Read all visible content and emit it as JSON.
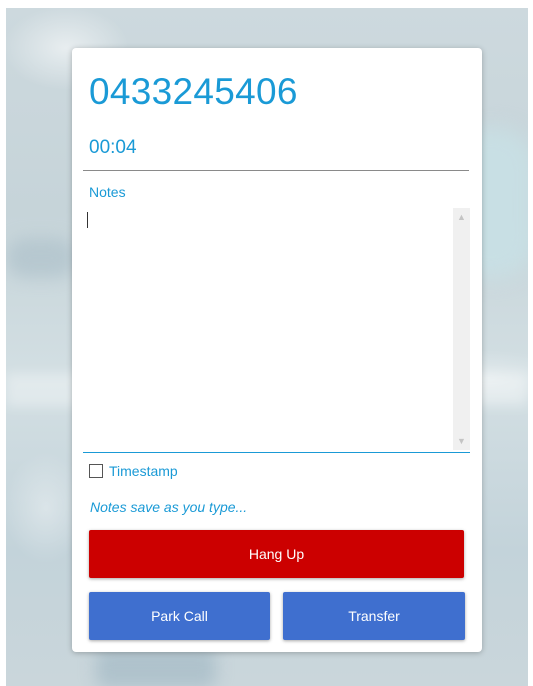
{
  "call": {
    "phone_number": "0433245406",
    "duration": "00:04"
  },
  "notes": {
    "label": "Notes",
    "value": "",
    "scroll_up_icon": "chevron-up-icon",
    "scroll_down_icon": "chevron-down-icon"
  },
  "timestamp": {
    "label": "Timestamp",
    "checked": false
  },
  "save_hint": "Notes save as you type...",
  "buttons": {
    "hang_up": "Hang Up",
    "park_call": "Park Call",
    "transfer": "Transfer"
  },
  "colors": {
    "accent": "#1a9ad6",
    "hang_up": "#cc0000",
    "secondary_button": "#3f6fcf"
  }
}
